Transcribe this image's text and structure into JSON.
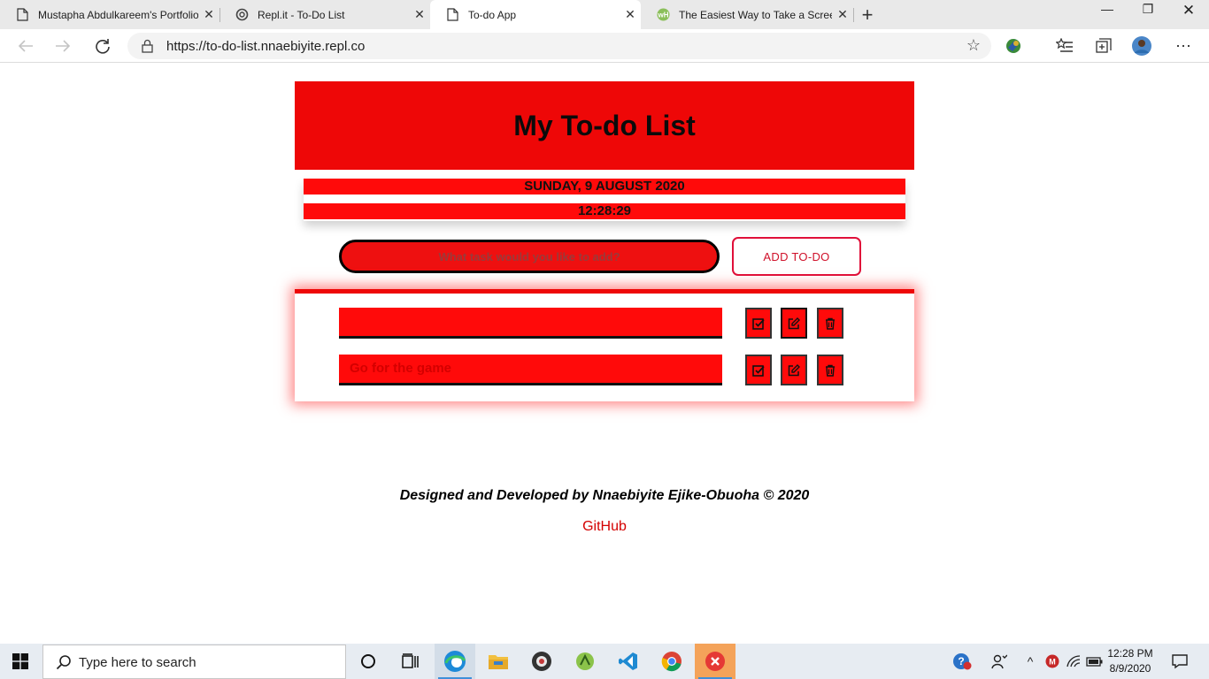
{
  "browser": {
    "tabs": [
      {
        "title": "Mustapha Abdulkareem's Portfolio",
        "icon": "page-icon"
      },
      {
        "title": "Repl.it - To-Do List",
        "icon": "replit-icon"
      },
      {
        "title": "To-do App",
        "icon": "page-icon"
      },
      {
        "title": "The Easiest Way to Take a Screenshot",
        "icon": "wikihow-icon"
      }
    ],
    "active_tab_index": 2,
    "url": "https://to-do-list.nnaebiyite.repl.co"
  },
  "page": {
    "title": "My To-do List",
    "date": "SUNDAY, 9 AUGUST 2020",
    "time": "12:28:29",
    "input_placeholder": "What task would you like to add?",
    "add_button_label": "ADD TO-DO",
    "todos": [
      {
        "text": ""
      },
      {
        "text": "Go for the game"
      }
    ],
    "footer_credit": "Designed and Developed by Nnaebiyite Ejike-Obuoha © 2020",
    "footer_link": "GitHub"
  },
  "colors": {
    "header_red": "#ee0707",
    "item_red": "#ff0a0a",
    "add_button_border": "#e0103a",
    "link": "#d40000"
  },
  "taskbar": {
    "search_placeholder": "Type here to search",
    "clock_time": "12:28 PM",
    "clock_date": "8/9/2020"
  }
}
